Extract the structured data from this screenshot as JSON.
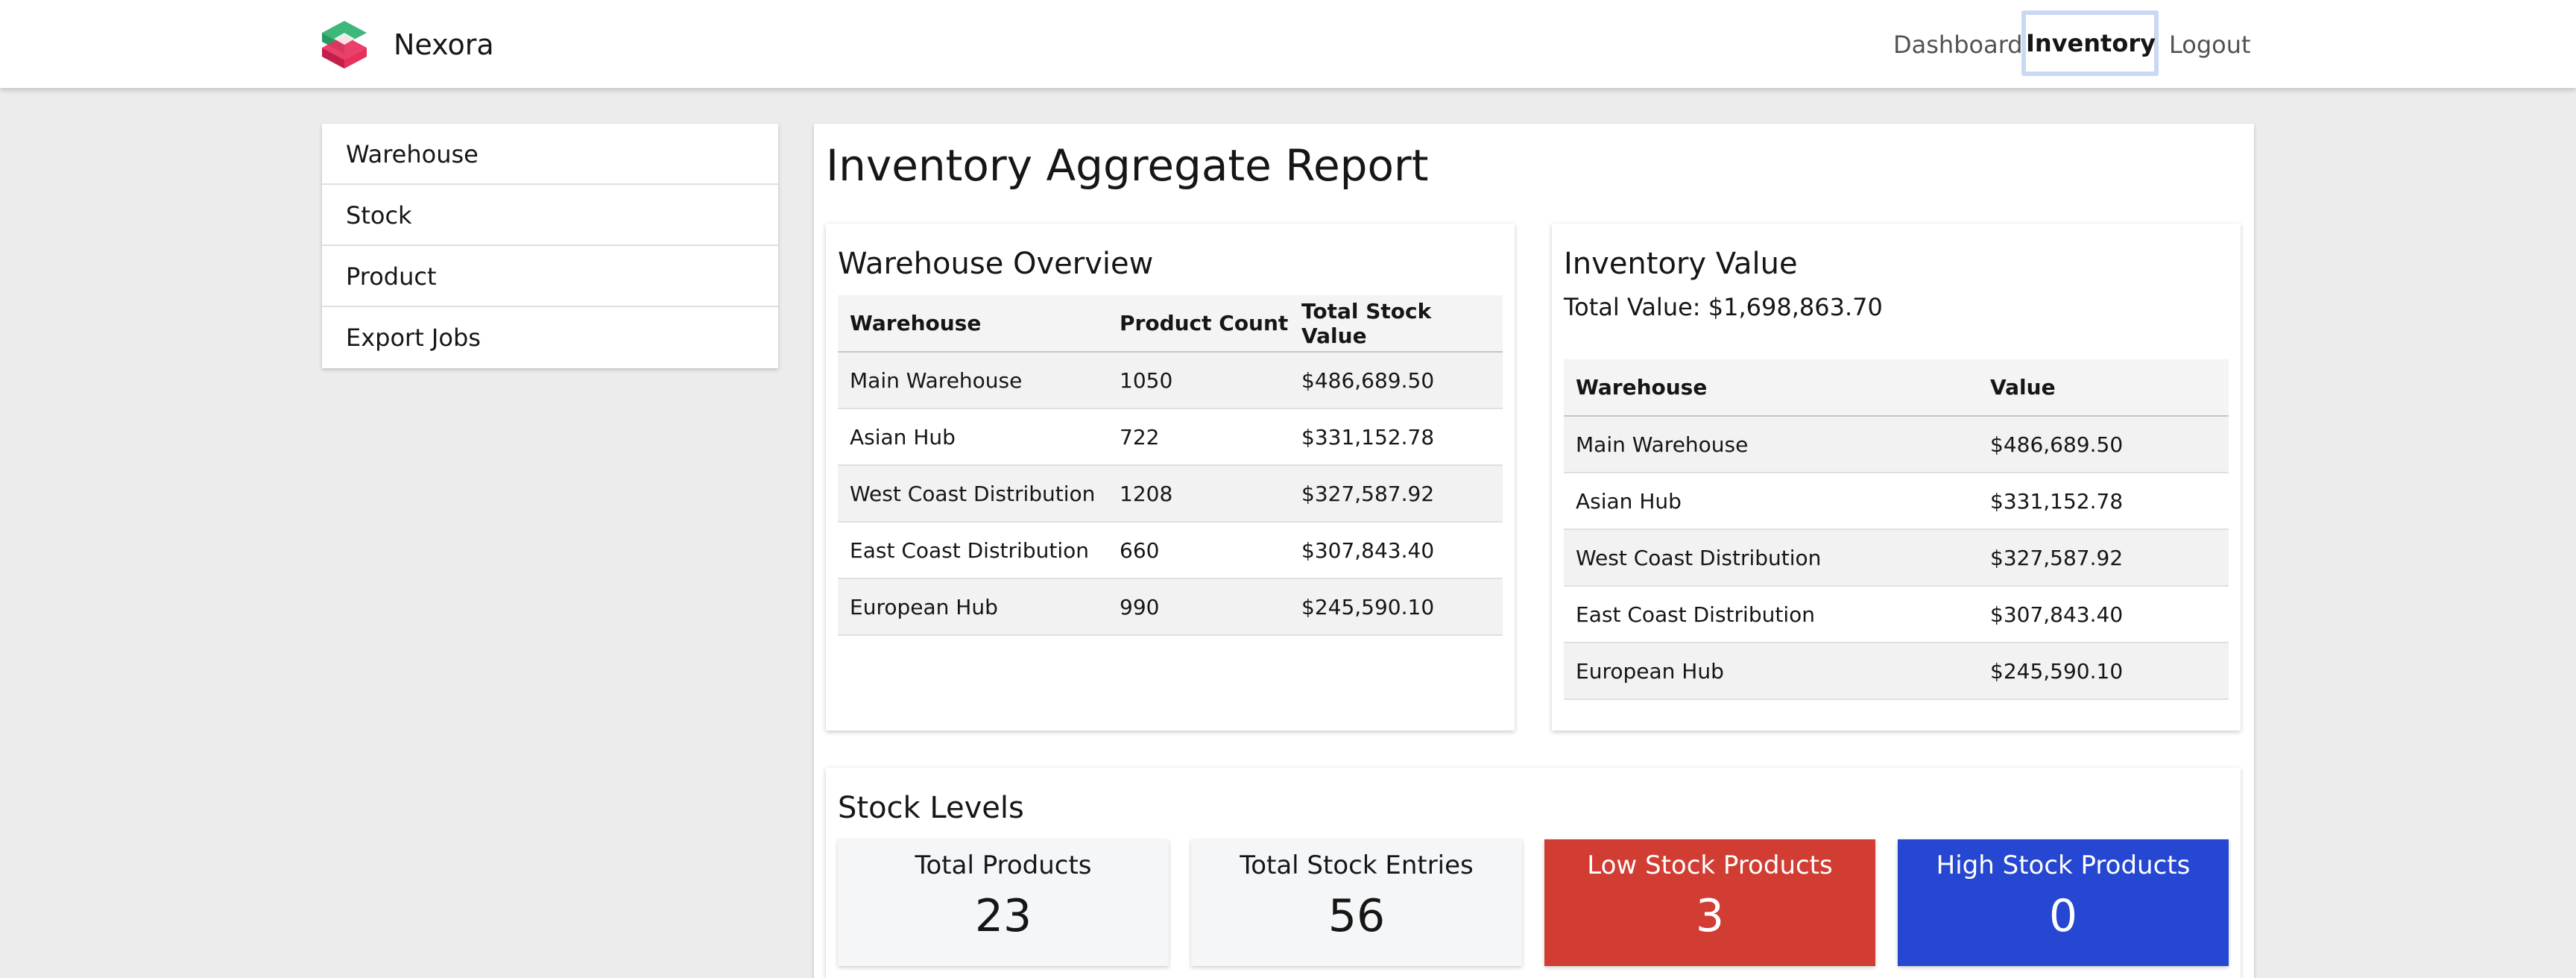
{
  "header": {
    "brand": "Nexora",
    "nav": {
      "dashboard": "Dashboard",
      "inventory": "Inventory",
      "logout": "Logout"
    }
  },
  "sidebar": {
    "items": [
      {
        "label": "Warehouse"
      },
      {
        "label": "Stock"
      },
      {
        "label": "Product"
      },
      {
        "label": "Export Jobs"
      }
    ]
  },
  "main": {
    "title": "Inventory Aggregate Report",
    "overview": {
      "title": "Warehouse Overview",
      "columns": [
        "Warehouse",
        "Product Count",
        "Total Stock Value"
      ],
      "rows": [
        [
          "Main Warehouse",
          "1050",
          "$486,689.50"
        ],
        [
          "Asian Hub",
          "722",
          "$331,152.78"
        ],
        [
          "West Coast Distribution",
          "1208",
          "$327,587.92"
        ],
        [
          "East Coast Distribution",
          "660",
          "$307,843.40"
        ],
        [
          "European Hub",
          "990",
          "$245,590.10"
        ]
      ]
    },
    "value": {
      "title": "Inventory Value",
      "total": "Total Value: $1,698,863.70",
      "columns": [
        "Warehouse",
        "Value"
      ],
      "rows": [
        [
          "Main Warehouse",
          "$486,689.50"
        ],
        [
          "Asian Hub",
          "$331,152.78"
        ],
        [
          "West Coast Distribution",
          "$327,587.92"
        ],
        [
          "East Coast Distribution",
          "$307,843.40"
        ],
        [
          "European Hub",
          "$245,590.10"
        ]
      ]
    },
    "stock": {
      "title": "Stock Levels",
      "tiles": [
        {
          "label": "Total Products",
          "value": "23"
        },
        {
          "label": "Total Stock Entries",
          "value": "56"
        },
        {
          "label": "Low Stock Products",
          "value": "3"
        },
        {
          "label": "High Stock Products",
          "value": "0"
        }
      ]
    }
  },
  "colors": {
    "low_stock": "#d13d33",
    "high_stock": "#2547d2",
    "logo_green": "#3db77a",
    "logo_pink": "#e8305d"
  }
}
